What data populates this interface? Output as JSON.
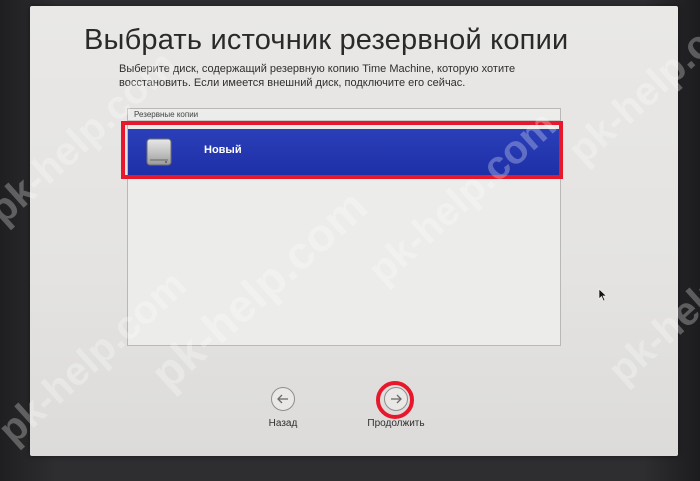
{
  "dialog": {
    "title": "Выбрать источник резервной копии",
    "subtitle": "Выберите диск, содержащий резервную копию Time Machine, которую хотите восстановить. Если имеется внешний диск, подключите его сейчас."
  },
  "backups": {
    "header": "Резервные копии",
    "items": [
      {
        "label": "Новый",
        "icon": "hard-disk-icon",
        "selected": true
      }
    ]
  },
  "navigation": {
    "back_label": "Назад",
    "continue_label": "Продолжить",
    "back_icon": "arrow-left-icon",
    "continue_icon": "arrow-right-icon"
  },
  "watermark": {
    "text": "pk-help.com"
  },
  "colors": {
    "selection": "#1e30a8",
    "annotation": "#e8182c",
    "dialog_bg": "#e6e5e3"
  }
}
